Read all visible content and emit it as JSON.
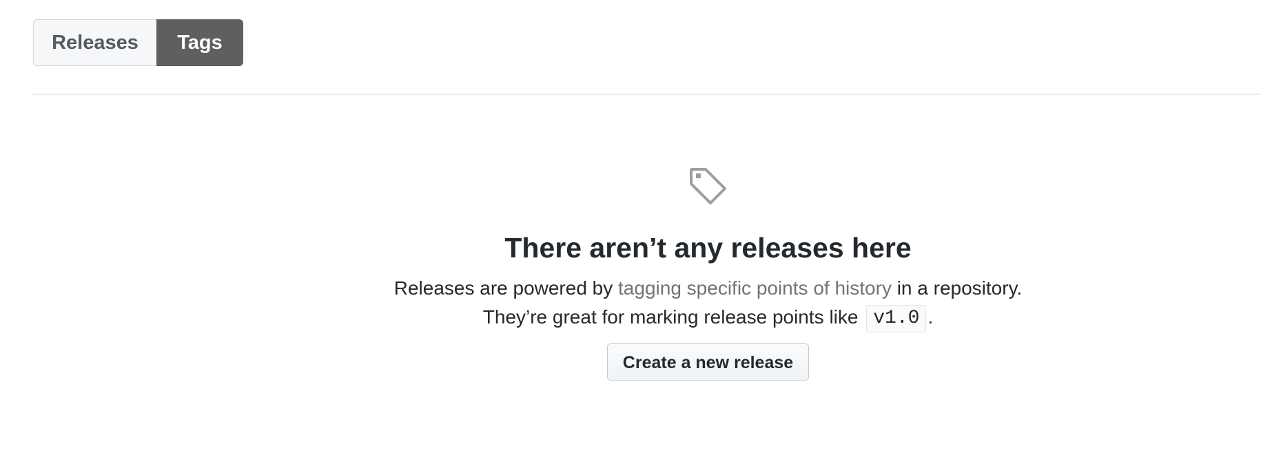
{
  "tabs": [
    {
      "label": "Releases",
      "selected": false
    },
    {
      "label": "Tags",
      "selected": true
    }
  ],
  "blankslate": {
    "icon": "tag-icon",
    "title": "There aren’t any releases here",
    "line1_before": "Releases are powered by ",
    "line1_link": "tagging specific points of history",
    "line1_after": " in a repository.",
    "line2_before": "They’re great for marking release points like ",
    "line2_code": "v1.0",
    "line2_after": ".",
    "button_label": "Create a new release"
  },
  "colors": {
    "selected_tab_bg": "#5f5f5f",
    "link": "#6f7479",
    "text": "#24292e"
  }
}
